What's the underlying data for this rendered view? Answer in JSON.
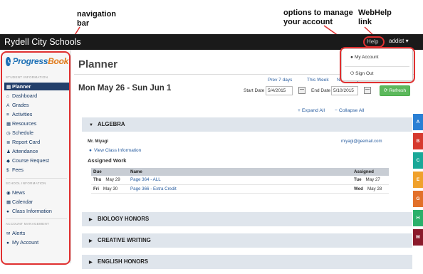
{
  "annotations": {
    "navigation_bar": [
      "navigation",
      "bar"
    ],
    "account_options": [
      "options to manage",
      "your account"
    ],
    "webhelp": [
      "WebHelp",
      "link"
    ]
  },
  "topbar": {
    "brand": "Rydell City Schools",
    "help_label": "Help",
    "account_label": "addist ▾"
  },
  "account_menu": {
    "my_account": "My Account",
    "sign_out": "Sign Out"
  },
  "sidebar": {
    "logo": {
      "part1": "Progress",
      "part2": "Book"
    },
    "sections": {
      "student_information": "STUDENT INFORMATION",
      "school_information": "SCHOOL INFORMATION",
      "account_management": "ACCOUNT MANAGEMENT"
    },
    "student_items": [
      {
        "icon": "▤",
        "label": "Planner"
      },
      {
        "icon": "⌂",
        "label": "Dashboard"
      },
      {
        "icon": "A",
        "label": "Grades"
      },
      {
        "icon": "≡",
        "label": "Activities"
      },
      {
        "icon": "▦",
        "label": "Resources"
      },
      {
        "icon": "◷",
        "label": "Schedule"
      },
      {
        "icon": "≣",
        "label": "Report Card"
      },
      {
        "icon": "♟",
        "label": "Attendance"
      },
      {
        "icon": "◆",
        "label": "Course Request"
      },
      {
        "icon": "$",
        "label": "Fees"
      }
    ],
    "school_items": [
      {
        "icon": "◉",
        "label": "News"
      },
      {
        "icon": "▦",
        "label": "Calendar"
      },
      {
        "icon": "●",
        "label": "Class Information"
      }
    ],
    "account_items": [
      {
        "icon": "✉",
        "label": "Alerts"
      },
      {
        "icon": "●",
        "label": "My Account"
      }
    ]
  },
  "planner": {
    "title": "Planner",
    "date_range": "Mon May 26 - Sun Jun 1",
    "prev_link": "Prev 7 days",
    "this_week_link": "This Week",
    "next_link": "Next 7 days",
    "start_date_label": "Start Date",
    "start_date_value": "5/4/2015",
    "end_date_label": "End Date",
    "end_date_value": "5/10/2015",
    "refresh_label": "Refresh",
    "expand_all": "+ Expand All",
    "collapse_all": "− Collapse All"
  },
  "classes": [
    {
      "name": "ALGEBRA",
      "expanded": true
    },
    {
      "name": "BIOLOGY HONORS",
      "expanded": false
    },
    {
      "name": "CREATIVE WRITING",
      "expanded": false
    },
    {
      "name": "ENGLISH HONORS",
      "expanded": false
    }
  ],
  "algebra_detail": {
    "teacher": "Mr. Miyagi",
    "email": "miyagi@geemail.com",
    "class_info_link": "View Class Information",
    "assigned_work_heading": "Assigned Work",
    "columns": [
      "Due",
      "Name",
      "Assigned"
    ],
    "rows": [
      {
        "due_day": "Thu",
        "due_date": "May 29",
        "name": "Page 364 - ALL",
        "asg_day": "Tue",
        "asg_date": "May 27"
      },
      {
        "due_day": "Fri",
        "due_date": "May 30",
        "name": "Page 366 - Extra Credit",
        "asg_day": "Wed",
        "asg_date": "May 28"
      }
    ]
  },
  "grade_tabs": [
    {
      "label": "A",
      "color": "#2a7fd4"
    },
    {
      "label": "B",
      "color": "#d63a2f"
    },
    {
      "label": "C",
      "color": "#1aa898"
    },
    {
      "label": "E",
      "color": "#f0a12b"
    },
    {
      "label": "G",
      "color": "#e2702a"
    },
    {
      "label": "H",
      "color": "#2bb06a"
    },
    {
      "label": "W",
      "color": "#8b1a2b"
    }
  ],
  "colors": {
    "topbar": "#1a1a1a",
    "active_nav": "#233f6b",
    "link": "#2a5ea0",
    "refresh": "#5cb85c",
    "annotation": "#e03030"
  }
}
